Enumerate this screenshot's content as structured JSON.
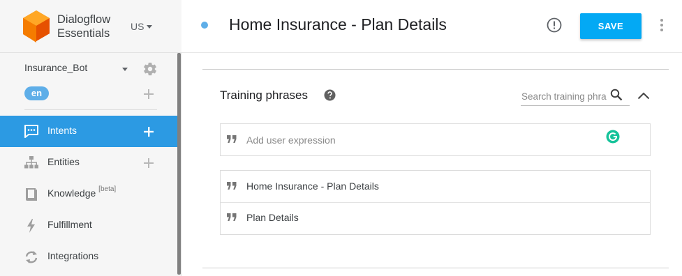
{
  "brand": {
    "line1": "Dialogflow",
    "line2": "Essentials",
    "region": "US"
  },
  "agent": {
    "name": "Insurance_Bot",
    "language": "en"
  },
  "nav": [
    {
      "label": "Intents",
      "icon": "chat-bubble-icon",
      "active": true
    },
    {
      "label": "Entities",
      "icon": "hierarchy-icon"
    },
    {
      "label": "Knowledge",
      "badge": "[beta]",
      "icon": "book-icon"
    },
    {
      "label": "Fulfillment",
      "icon": "bolt-icon"
    },
    {
      "label": "Integrations",
      "icon": "sync-icon"
    }
  ],
  "header": {
    "title": "Home Insurance - Plan Details",
    "save_label": "SAVE"
  },
  "training": {
    "title": "Training phrases",
    "search_placeholder": "Search training phrases",
    "add_placeholder": "Add user expression",
    "phrases": [
      "Home Insurance - Plan Details",
      "Plan Details"
    ]
  },
  "colors": {
    "accent": "#2c9ae3",
    "save": "#03a9f4",
    "badge": "#5eaee8",
    "grammarly": "#15c39a"
  }
}
